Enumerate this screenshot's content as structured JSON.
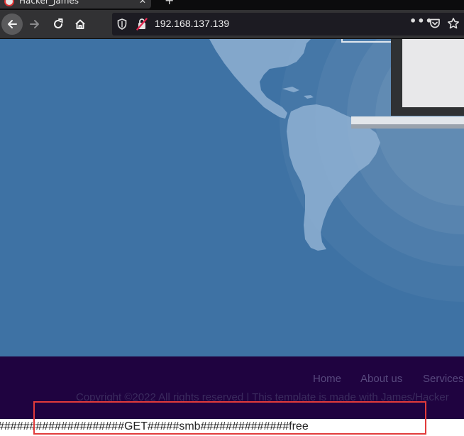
{
  "browser": {
    "tab_title": "Hacker_James",
    "url": "192.168.137.139"
  },
  "icons": {
    "back": "back-arrow-icon",
    "forward": "forward-arrow-icon",
    "reload": "reload-icon",
    "home": "home-icon",
    "tracking": "shield-icon",
    "insecure": "insecure-lock-icon",
    "more": "more-icon",
    "pocket": "pocket-icon",
    "bookmark": "star-icon"
  },
  "footer": {
    "nav": [
      "Home",
      "About us",
      "Services"
    ],
    "copyright": "Copyright ©2022 All rights reserved | This template is made with James/Hacker"
  },
  "page_text": "####################GET#####smb##############free",
  "colors": {
    "hero_bg": "#3e72a4",
    "footer_bg": "#1f0340",
    "highlight": "#e23b3b"
  }
}
